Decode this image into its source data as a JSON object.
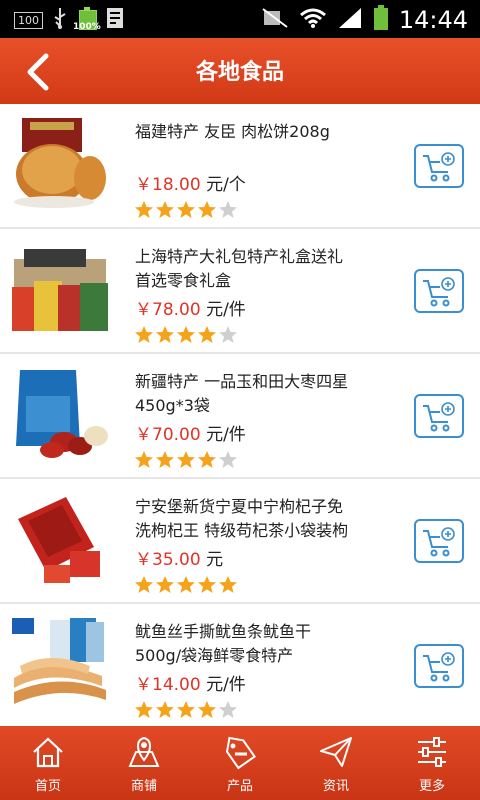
{
  "status": {
    "badge": "100",
    "battery_label": "100%",
    "time": "14:44"
  },
  "header": {
    "title": "各地食品"
  },
  "colors": {
    "primary": "#d23a17",
    "price": "#e23324",
    "accent_blue": "#3a8fd0",
    "star_on": "#f5a31a",
    "star_off": "#cfcfcf"
  },
  "products": [
    {
      "name_lines": [
        "福建特产 友臣 肉松饼208g"
      ],
      "price": "￥18.00",
      "unit": "元/个",
      "rating": 4
    },
    {
      "name_lines": [
        "上海特产大礼包特产礼盒送礼",
        "首选零食礼盒"
      ],
      "price": "￥78.00",
      "unit": "元/件",
      "rating": 4
    },
    {
      "name_lines": [
        "新疆特产 一品玉和田大枣四星",
        "450g*3袋"
      ],
      "price": "￥70.00",
      "unit": "元/件",
      "rating": 4
    },
    {
      "name_lines": [
        "宁安堡新货宁夏中宁枸杞子免",
        "洗枸杞王 特级苟杞茶小袋装枸"
      ],
      "price": "￥35.00",
      "unit": "元",
      "rating": 5
    },
    {
      "name_lines": [
        "鱿鱼丝手撕鱿鱼条鱿鱼干",
        "500g/袋海鲜零食特产"
      ],
      "price": "￥14.00",
      "unit": "元/件",
      "rating": 4
    }
  ],
  "nav": {
    "tabs": [
      {
        "label": "首页",
        "icon": "home-icon"
      },
      {
        "label": "商铺",
        "icon": "map-pin-icon"
      },
      {
        "label": "产品",
        "icon": "sale-tag-icon"
      },
      {
        "label": "资讯",
        "icon": "paper-plane-icon"
      },
      {
        "label": "更多",
        "icon": "sliders-icon"
      }
    ]
  }
}
